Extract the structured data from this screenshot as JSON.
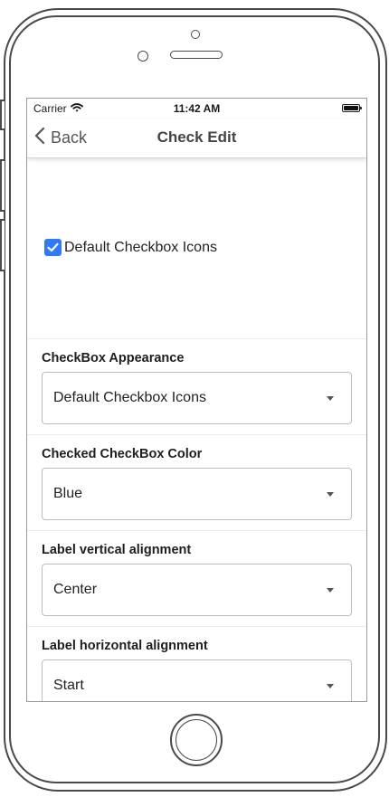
{
  "status_bar": {
    "carrier": "Carrier",
    "time": "11:42 AM"
  },
  "nav": {
    "back_label": "Back",
    "title": "Check Edit"
  },
  "checkbox": {
    "label": "Default Checkbox Icons",
    "checked": true,
    "color": "#2f7bf5"
  },
  "fields": [
    {
      "label": "CheckBox Appearance",
      "value": "Default Checkbox Icons"
    },
    {
      "label": "Checked CheckBox Color",
      "value": "Blue"
    },
    {
      "label": "Label vertical alignment",
      "value": "Center"
    },
    {
      "label": "Label horizontal alignment",
      "value": "Start"
    }
  ]
}
